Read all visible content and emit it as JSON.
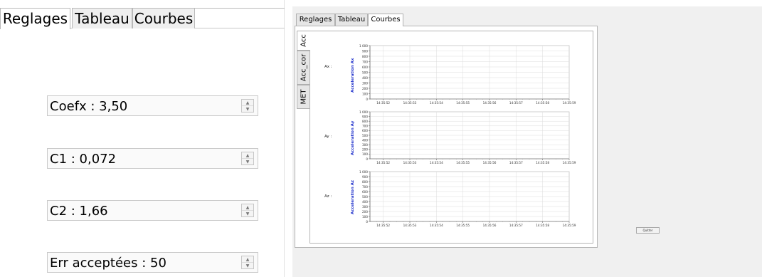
{
  "left": {
    "tabs": [
      {
        "label": "Reglages"
      },
      {
        "label": "Tableau"
      },
      {
        "label": "Courbes"
      }
    ],
    "fields": [
      {
        "value": "Coefx : 3,50"
      },
      {
        "value": "C1 : 0,072"
      },
      {
        "value": "C2 : 1,66"
      },
      {
        "value": "Err acceptées : 50"
      }
    ]
  },
  "window": {
    "tabs": [
      {
        "label": "Reglages"
      },
      {
        "label": "Tableau"
      },
      {
        "label": "Courbes"
      }
    ],
    "side_tabs": [
      {
        "label": "Acc"
      },
      {
        "label": "Acc_cor"
      },
      {
        "label": "MET"
      }
    ],
    "quit_label": "Quitter"
  },
  "chart_data": [
    {
      "type": "line",
      "row_label": "Ax :",
      "ylabel": "Acceleration Ax",
      "ylim": [
        0,
        1000
      ],
      "yticks": [
        "1 000",
        "900",
        "800",
        "700",
        "600",
        "500",
        "400",
        "300",
        "200",
        "100",
        "0"
      ],
      "xticks": [
        "14:35:52",
        "14:35:53",
        "14:35:54",
        "14:35:55",
        "14:35:56",
        "14:35:57",
        "14:35:58",
        "14:35:59"
      ],
      "series": [],
      "grid": true
    },
    {
      "type": "line",
      "row_label": "Ay :",
      "ylabel": "Acceleration Ay",
      "ylim": [
        0,
        1000
      ],
      "yticks": [
        "1 000",
        "900",
        "800",
        "700",
        "600",
        "500",
        "400",
        "300",
        "200",
        "100",
        "0"
      ],
      "xticks": [
        "14:35:52",
        "14:35:53",
        "14:35:54",
        "14:35:55",
        "14:35:56",
        "14:35:57",
        "14:35:58",
        "14:35:59"
      ],
      "series": [],
      "grid": true
    },
    {
      "type": "line",
      "row_label": "Az :",
      "ylabel": "Acceleration Az",
      "ylim": [
        0,
        1000
      ],
      "yticks": [
        "1 000",
        "900",
        "800",
        "700",
        "600",
        "500",
        "400",
        "300",
        "200",
        "100",
        "0"
      ],
      "xticks": [
        "14:35:52",
        "14:35:53",
        "14:35:54",
        "14:35:55",
        "14:35:56",
        "14:35:57",
        "14:35:58",
        "14:35:59"
      ],
      "series": [],
      "grid": true
    }
  ]
}
